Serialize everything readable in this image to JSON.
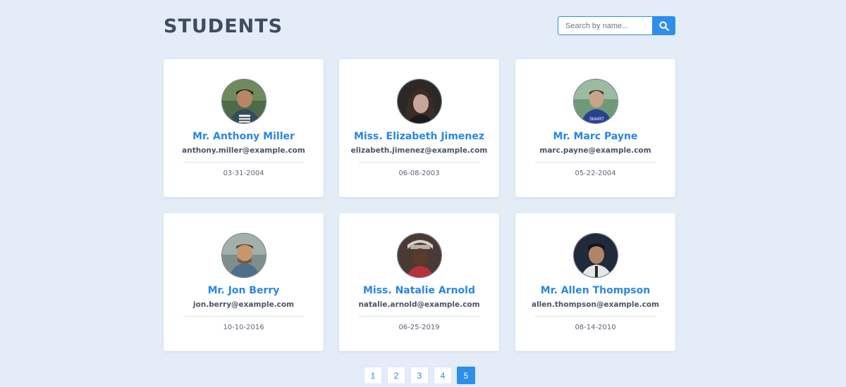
{
  "header": {
    "title": "STUDENTS",
    "search_placeholder": "Search by name...",
    "search_icon": "magnifier-icon"
  },
  "students": [
    {
      "name": "Mr. Anthony Miller",
      "email": "anthony.miller@example.com",
      "dob": "03-31-2004"
    },
    {
      "name": "Miss. Elizabeth Jimenez",
      "email": "elizabeth.jimenez@example.com",
      "dob": "06-08-2003"
    },
    {
      "name": "Mr. Marc Payne",
      "email": "marc.payne@example.com",
      "dob": "05-22-2004"
    },
    {
      "name": "Mr. Jon Berry",
      "email": "jon.berry@example.com",
      "dob": "10-10-2016"
    },
    {
      "name": "Miss. Natalie Arnold",
      "email": "natalie.arnold@example.com",
      "dob": "06-25-2019"
    },
    {
      "name": "Mr. Allen Thompson",
      "email": "allen.thompson@example.com",
      "dob": "08-14-2010"
    }
  ],
  "pagination": {
    "pages": [
      "1",
      "2",
      "3",
      "4",
      "5"
    ],
    "current": "5"
  },
  "colors": {
    "accent": "#2d8fea",
    "background": "#e3ecf7",
    "title": "#3f4c5e"
  }
}
